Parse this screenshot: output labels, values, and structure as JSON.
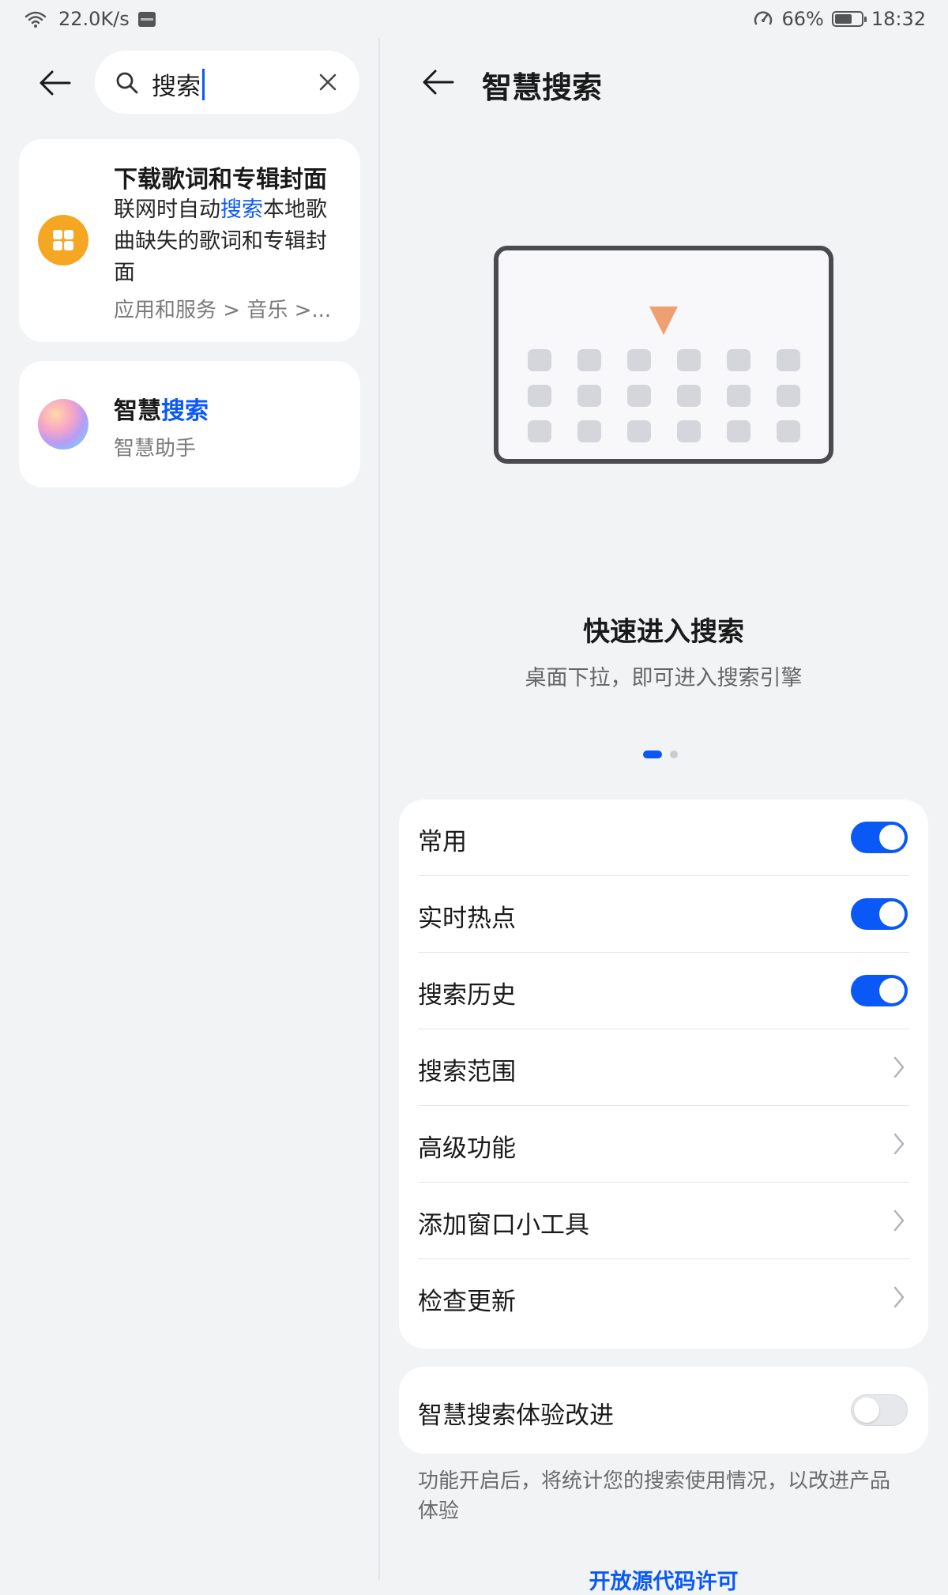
{
  "status_bar": {
    "net_speed": "22.0K/s",
    "battery_percent_text": "66%",
    "battery_level": 0.66,
    "time": "18:32"
  },
  "left_pane": {
    "search_query": "搜索",
    "results": [
      {
        "title": "下载歌词和专辑封面",
        "desc_before": "联网时自动",
        "desc_highlight": "搜索",
        "desc_line1_after": "本地歌",
        "desc_line2": "曲缺失的歌词和专辑封",
        "desc_line3": "面",
        "path": "应用和服务 > 音乐 >..."
      },
      {
        "title_plain": "智慧",
        "title_highlight": "搜索",
        "subtitle": "智慧助手"
      }
    ]
  },
  "right_pane": {
    "title": "智慧搜索",
    "feature_title": "快速进入搜索",
    "feature_desc": "桌面下拉，即可进入搜索引擎",
    "settings": [
      {
        "label": "常用",
        "type": "toggle",
        "on": true
      },
      {
        "label": "实时热点",
        "type": "toggle",
        "on": true
      },
      {
        "label": "搜索历史",
        "type": "toggle",
        "on": true
      },
      {
        "label": "搜索范围",
        "type": "nav"
      },
      {
        "label": "高级功能",
        "type": "nav"
      },
      {
        "label": "添加窗口小工具",
        "type": "nav"
      },
      {
        "label": "检查更新",
        "type": "nav"
      }
    ],
    "improve": {
      "label": "智慧搜索体验改进",
      "on": false
    },
    "improve_note": "功能开启后，将统计您的搜索使用情况，以改进产品体验",
    "oss_link": "开放源代码许可"
  },
  "colors": {
    "accent": "#0a59f7",
    "background": "#f1f3f5",
    "music_icon": "#f5a623"
  }
}
